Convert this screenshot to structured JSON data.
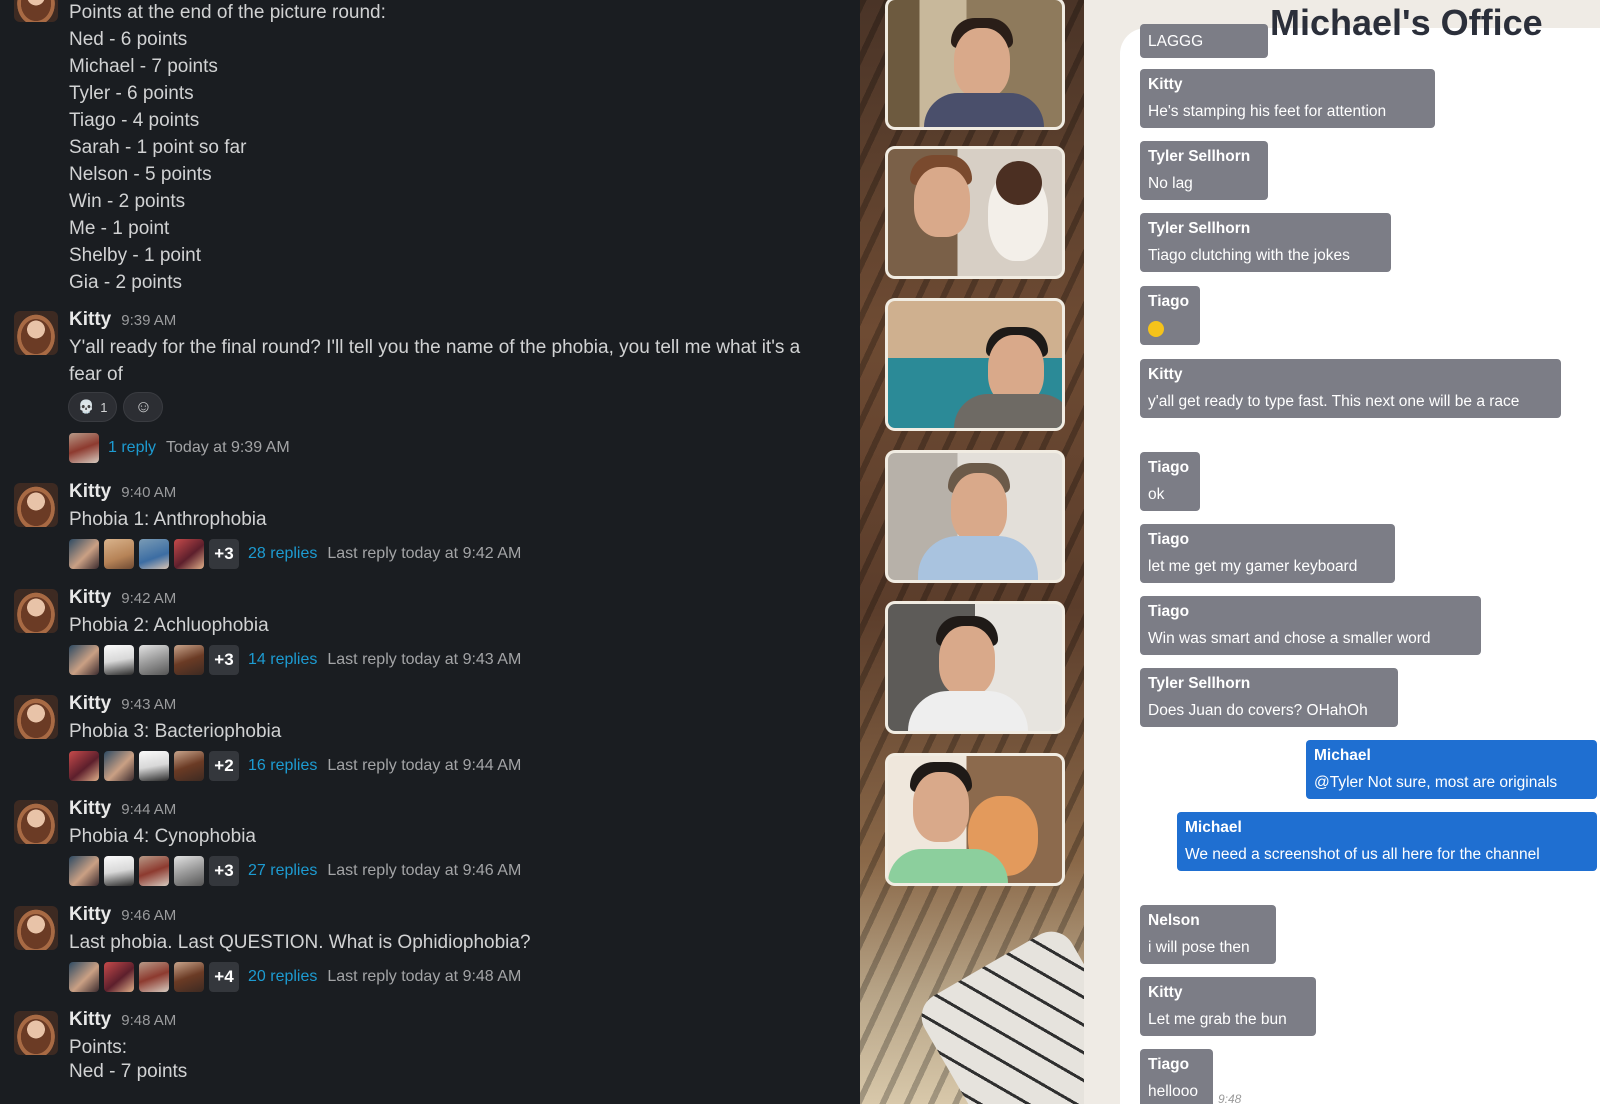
{
  "slack": {
    "scores_top": [
      "Points at the end of the picture round:",
      "Ned - 6 points",
      "Michael - 7 points",
      "Tyler - 6 points",
      "Tiago - 4 points",
      "Sarah - 1 point so far",
      "Nelson - 5 points",
      "Win - 2 points",
      "Me - 1 point",
      "Shelby - 1 point",
      "Gia - 2 points"
    ],
    "messages": [
      {
        "author": "Kitty",
        "time": "9:39 AM",
        "text": "Y'all ready for the final round? I'll tell you the name of the phobia, you tell me what it's a fear of",
        "reaction_count": "1",
        "reaction_icon": "skull-icon",
        "replies": "1 reply",
        "reply_meta": "Today at 9:39 AM"
      },
      {
        "author": "Kitty",
        "time": "9:40 AM",
        "text": "Phobia 1: Anthrophobia",
        "more": "+3",
        "replies": "28 replies",
        "reply_meta": "Last reply today at 9:42 AM"
      },
      {
        "author": "Kitty",
        "time": "9:42 AM",
        "text": "Phobia 2: Achluophobia",
        "more": "+3",
        "replies": "14 replies",
        "reply_meta": "Last reply today at 9:43 AM"
      },
      {
        "author": "Kitty",
        "time": "9:43 AM",
        "text": "Phobia 3: Bacteriophobia",
        "more": "+2",
        "replies": "16 replies",
        "reply_meta": "Last reply today at 9:44 AM"
      },
      {
        "author": "Kitty",
        "time": "9:44 AM",
        "text": "Phobia 4: Cynophobia",
        "more": "+3",
        "replies": "27 replies",
        "reply_meta": "Last reply today at 9:46 AM"
      },
      {
        "author": "Kitty",
        "time": "9:46 AM",
        "text": "Last phobia. Last QUESTION. What is Ophidiophobia?",
        "more": "+4",
        "replies": "20 replies",
        "reply_meta": "Last reply today at 9:48 AM"
      },
      {
        "author": "Kitty",
        "time": "9:48 AM",
        "text": "Points:",
        "extra_line": "Ned - 7 points"
      }
    ]
  },
  "chat": {
    "title": "Michael's Office",
    "messages": [
      {
        "author": "",
        "text": "LAGGG"
      },
      {
        "author": "Kitty",
        "text": "He's stamping his feet for attention"
      },
      {
        "author": "Tyler Sellhorn",
        "text": "No lag"
      },
      {
        "author": "Tyler Sellhorn",
        "text": "Tiago clutching with the jokes"
      },
      {
        "author": "Tiago",
        "text": "",
        "emoji": "grinning-face-icon"
      },
      {
        "author": "Kitty",
        "text": "y'all get ready to type fast. This next one will be a race"
      },
      {
        "author": "Tiago",
        "text": "ok"
      },
      {
        "author": "Tiago",
        "text": "let me get my gamer keyboard"
      },
      {
        "author": "Tiago",
        "text": "Win was smart and chose a smaller word"
      },
      {
        "author": "Tyler Sellhorn",
        "text": "Does Juan do covers? OHahOh"
      },
      {
        "author": "Michael",
        "text": "@Tyler Not sure, most are originals"
      },
      {
        "author": "Michael",
        "text": "We need a screenshot of us all here for the channel"
      },
      {
        "author": "Nelson",
        "text": "i will pose then"
      },
      {
        "author": "Kitty",
        "text": "Let me grab the bun"
      },
      {
        "author": "Tiago",
        "text": "hellooo"
      }
    ],
    "last_time": "9:48"
  },
  "colors": {
    "slack_bg": "#1a1d21",
    "link": "#1d9bd1",
    "bubble_in": "#7c7d86",
    "bubble_out": "#1f6fd1"
  }
}
